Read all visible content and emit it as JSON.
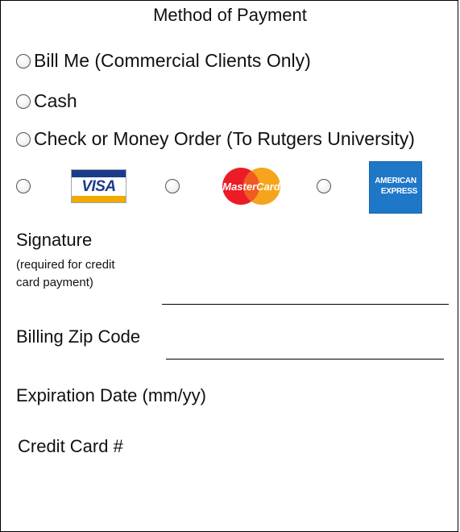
{
  "form": {
    "title": "Method of Payment",
    "options": [
      {
        "label": "Bill Me (Commercial Clients Only)"
      },
      {
        "label": "Cash"
      },
      {
        "label": "Check or Money Order (To Rutgers University)"
      }
    ],
    "cards": [
      {
        "name": "visa",
        "text": "VISA"
      },
      {
        "name": "mastercard",
        "text": "MasterCard"
      },
      {
        "name": "american-express",
        "line1": "AMERICAN",
        "line2": "EXPRESS"
      }
    ],
    "signature": {
      "label": "Signature",
      "note_line1": "(required for credit",
      "note_line2": "card payment)"
    },
    "zip": {
      "label": "Billing Zip Code"
    },
    "expiration": {
      "label": "Expiration Date (mm/yy)"
    },
    "credit_card": {
      "label": "Credit Card #"
    }
  },
  "colors": {
    "visa_blue": "#1b3a8a",
    "visa_gold": "#f2a900",
    "mastercard_red": "#eb1c26",
    "mastercard_yellow": "#f6a41c",
    "amex_blue": "#1f77c8"
  }
}
